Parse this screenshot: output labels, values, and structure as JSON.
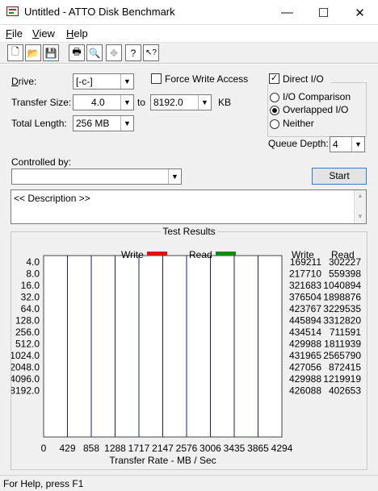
{
  "window": {
    "title": "Untitled - ATTO Disk Benchmark",
    "minimize": "—",
    "maximize": "☐",
    "close": "✕"
  },
  "menu": [
    {
      "pre": "",
      "u": "F",
      "post": "ile"
    },
    {
      "pre": "",
      "u": "V",
      "post": "iew"
    },
    {
      "pre": "",
      "u": "H",
      "post": "elp"
    }
  ],
  "toolbar": {
    "buttons": [
      {
        "name": "new-icon",
        "glyph": "🗋"
      },
      {
        "name": "open-icon",
        "glyph": "📂"
      },
      {
        "name": "save-icon",
        "glyph": "💾"
      },
      {
        "name": "print-icon",
        "glyph": "🖶"
      },
      {
        "name": "print-preview-icon",
        "glyph": "🔍"
      },
      {
        "name": "move-icon",
        "glyph": "✥"
      },
      {
        "name": "help-icon",
        "glyph": "?"
      },
      {
        "name": "context-help-icon",
        "glyph": "↖?"
      }
    ]
  },
  "settings": {
    "drive_label": "Drive:",
    "drive_value": "[-c-]",
    "transfer_size_label": "Transfer Size:",
    "transfer_from": "4.0",
    "to_label": "to",
    "transfer_to": "8192.0",
    "kb_label": "KB",
    "total_length_label": "Total Length:",
    "total_length_value": "256 MB",
    "force_write_label": "Force Write Access",
    "force_write_checked": false,
    "direct_io_label": "Direct I/O",
    "direct_io_checked": true,
    "io_comparison_label": "I/O Comparison",
    "overlapped_io_label": "Overlapped I/O",
    "neither_label": "Neither",
    "io_mode_selected": "Overlapped I/O",
    "queue_depth_label": "Queue Depth:",
    "queue_depth_value": "4",
    "controlled_by_label": "Controlled by:",
    "controlled_by_value": "",
    "start_button": "Start",
    "description": "<< Description >>"
  },
  "chart_data": {
    "type": "bar",
    "title": "Test Results",
    "legend": [
      {
        "name": "Write",
        "color": "#e01010"
      },
      {
        "name": "Read",
        "color": "#128a12"
      }
    ],
    "legend_placement": "top",
    "categories": [
      "4.0",
      "8.0",
      "16.0",
      "32.0",
      "64.0",
      "128.0",
      "256.0",
      "512.0",
      "1024.0",
      "2048.0",
      "4096.0",
      "8192.0"
    ],
    "series": [
      {
        "name": "Write",
        "values": [
          169211,
          217710,
          321683,
          376504,
          423767,
          445894,
          434514,
          429988,
          431965,
          427056,
          429988,
          426088
        ]
      },
      {
        "name": "Read",
        "values": [
          302227,
          559398,
          1040894,
          1898876,
          3229535,
          3312820,
          711591,
          1811939,
          2565790,
          872415,
          1219919,
          402653
        ]
      }
    ],
    "column_headers": [
      "Write",
      "Read"
    ],
    "x_ticks": [
      "0",
      "429",
      "858",
      "1288",
      "1717",
      "2147",
      "2576",
      "3006",
      "3435",
      "3865",
      "4294"
    ],
    "xlabel": "Transfer Rate - MB / Sec",
    "xlim": [
      0,
      4294
    ],
    "grid": true
  },
  "status": {
    "text": "For Help, press F1"
  },
  "colors": {
    "write": "#e01010",
    "read": "#128a12",
    "grid": "#1a1a8c",
    "accent": "#2f7bd2"
  }
}
